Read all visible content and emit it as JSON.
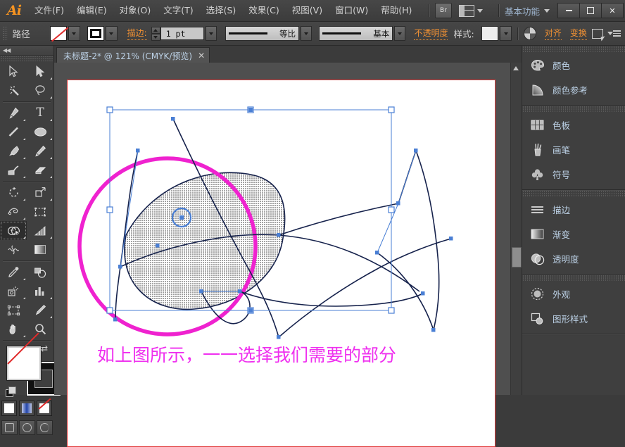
{
  "app": {
    "logo": "Ai",
    "workspace": "基本功能",
    "bridge_button": "Br"
  },
  "menubar": {
    "items": [
      {
        "label": "文件(F)",
        "name": "menu-file"
      },
      {
        "label": "编辑(E)",
        "name": "menu-edit"
      },
      {
        "label": "对象(O)",
        "name": "menu-object"
      },
      {
        "label": "文字(T)",
        "name": "menu-type"
      },
      {
        "label": "选择(S)",
        "name": "menu-select"
      },
      {
        "label": "效果(C)",
        "name": "menu-effect"
      },
      {
        "label": "视图(V)",
        "name": "menu-view"
      },
      {
        "label": "窗口(W)",
        "name": "menu-window"
      },
      {
        "label": "帮助(H)",
        "name": "menu-help"
      }
    ],
    "window_controls": {
      "minimize": "—",
      "maximize": "□",
      "close": "✕"
    }
  },
  "controlbar": {
    "object_type": "路径",
    "fill_label": "fill-swatch",
    "stroke_swatch_label": "stroke-swatch",
    "stroke_label": "描边:",
    "stroke_weight": "1 pt",
    "width_profile": "等比",
    "brush_definition": "基本",
    "opacity_label": "不透明度",
    "style_label": "样式:",
    "align_label": "对齐",
    "transform_label": "变换"
  },
  "tabs": [
    {
      "title": "未标题-2* @ 121% (CMYK/预览)",
      "close": "✕",
      "active": true
    }
  ],
  "toolbar": {
    "collapse": "◀◀",
    "tools": [
      {
        "name": "selection-tool",
        "glyph": "selection"
      },
      {
        "name": "direct-selection-tool",
        "glyph": "direct-selection"
      },
      {
        "name": "magic-wand-tool",
        "glyph": "magic-wand"
      },
      {
        "name": "lasso-tool",
        "glyph": "lasso"
      },
      {
        "name": "pen-tool",
        "glyph": "pen"
      },
      {
        "name": "type-tool",
        "glyph": "type"
      },
      {
        "name": "line-segment-tool",
        "glyph": "line"
      },
      {
        "name": "ellipse-tool",
        "glyph": "ellipse"
      },
      {
        "name": "paintbrush-tool",
        "glyph": "paintbrush"
      },
      {
        "name": "pencil-tool",
        "glyph": "pencil"
      },
      {
        "name": "blob-brush-tool",
        "glyph": "blob-brush"
      },
      {
        "name": "eraser-tool",
        "glyph": "eraser"
      },
      {
        "name": "rotate-tool",
        "glyph": "rotate"
      },
      {
        "name": "scale-tool",
        "glyph": "scale"
      },
      {
        "name": "width-tool",
        "glyph": "width"
      },
      {
        "name": "free-transform-tool",
        "glyph": "free-transform"
      },
      {
        "name": "shape-builder-tool",
        "glyph": "shape-builder",
        "selected": true
      },
      {
        "name": "perspective-grid-tool",
        "glyph": "perspective"
      },
      {
        "name": "mesh-tool",
        "glyph": "mesh"
      },
      {
        "name": "gradient-tool",
        "glyph": "gradient"
      },
      {
        "name": "eyedropper-tool",
        "glyph": "eyedropper"
      },
      {
        "name": "blend-tool",
        "glyph": "blend"
      },
      {
        "name": "symbol-sprayer-tool",
        "glyph": "symbol-sprayer"
      },
      {
        "name": "column-graph-tool",
        "glyph": "column-graph"
      },
      {
        "name": "artboard-tool",
        "glyph": "artboard"
      },
      {
        "name": "slice-tool",
        "glyph": "slice"
      },
      {
        "name": "hand-tool",
        "glyph": "hand"
      },
      {
        "name": "zoom-tool",
        "glyph": "zoom"
      }
    ]
  },
  "panels": {
    "groups": [
      {
        "name": "color-group",
        "items": [
          {
            "label": "颜色",
            "icon": "palette-icon",
            "name": "panel-color"
          },
          {
            "label": "颜色参考",
            "icon": "color-guide-icon",
            "name": "panel-color-guide"
          }
        ]
      },
      {
        "name": "swatches-group",
        "items": [
          {
            "label": "色板",
            "icon": "swatches-grid-icon",
            "name": "panel-swatches"
          },
          {
            "label": "画笔",
            "icon": "brushes-icon",
            "name": "panel-brushes"
          },
          {
            "label": "符号",
            "icon": "symbols-clover-icon",
            "name": "panel-symbols"
          }
        ]
      },
      {
        "name": "stroke-group",
        "items": [
          {
            "label": "描边",
            "icon": "stroke-lines-icon",
            "name": "panel-stroke"
          },
          {
            "label": "渐变",
            "icon": "gradient-icon",
            "name": "panel-gradient"
          },
          {
            "label": "透明度",
            "icon": "transparency-icon",
            "name": "panel-transparency"
          }
        ]
      },
      {
        "name": "appearance-group",
        "items": [
          {
            "label": "外观",
            "icon": "appearance-circle-icon",
            "name": "panel-appearance"
          },
          {
            "label": "图形样式",
            "icon": "graphic-styles-icon",
            "name": "panel-graphic-styles"
          }
        ]
      }
    ]
  },
  "canvas": {
    "caption": "如上图所示，一一选择我们需要的部分",
    "caption_color": "#ef30ef",
    "artboard_border_color": "#e03b3b",
    "circle_color": "#ef22cf",
    "path_color": "#16224c",
    "selection_color": "#4a7fd4",
    "zoom_level": "121%",
    "color_mode": "CMYK/预览"
  }
}
